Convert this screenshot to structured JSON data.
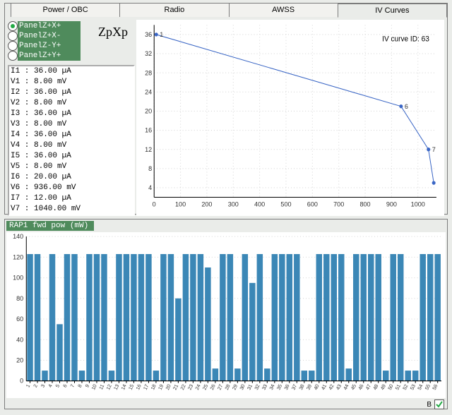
{
  "tabs": {
    "items": [
      "Power / OBC",
      "Radio",
      "AWSS",
      "IV Curves"
    ],
    "active": 3
  },
  "iv": {
    "panel_label": "ZpXp",
    "radios": [
      {
        "label": "PanelZ+X+",
        "checked": true
      },
      {
        "label": "PanelZ+X-",
        "checked": false
      },
      {
        "label": "PanelZ-Y+",
        "checked": false
      },
      {
        "label": "PanelZ+Y+",
        "checked": false
      }
    ],
    "readings_text": [
      "I1 : 36.00 µA",
      "V1 : 8.00 mV",
      "I2 : 36.00 µA",
      "V2 : 8.00 mV",
      "I3 : 36.00 µA",
      "V3 : 8.00 mV",
      "I4 : 36.00 µA",
      "V4 : 8.00 mV",
      "I5 : 36.00 µA",
      "V5 : 8.00 mV",
      "I6 : 20.00 µA",
      "V6 : 936.00 mV",
      "I7 : 12.00 µA",
      "V7 : 1040.00 mV"
    ],
    "annotation": "IV curve ID: 63"
  },
  "bottom": {
    "title": "RAP1 fwd pow (mW)",
    "checkbox_label": "B",
    "checked": true
  },
  "chart_data": [
    {
      "type": "line",
      "title": "",
      "xlabel": "",
      "ylabel": "",
      "x_ticks": [
        0,
        100,
        200,
        300,
        400,
        500,
        600,
        700,
        800,
        900,
        1000
      ],
      "y_ticks": [
        4,
        8,
        12,
        16,
        20,
        24,
        28,
        32,
        36
      ],
      "xlim": [
        0,
        1070
      ],
      "ylim": [
        2,
        38
      ],
      "annotation": "IV curve ID: 63",
      "series": [
        {
          "name": "IV",
          "color": "#3a66c5",
          "x": [
            8,
            936,
            1040,
            1060
          ],
          "y": [
            36,
            21,
            12,
            5
          ],
          "marker_label": [
            "1",
            "6",
            "7",
            ""
          ]
        }
      ]
    },
    {
      "type": "bar",
      "title": "RAP1 fwd pow (mW)",
      "xlabel": "",
      "ylabel": "",
      "y_ticks": [
        0,
        20,
        40,
        60,
        80,
        100,
        120,
        140
      ],
      "ylim": [
        0,
        140
      ],
      "categories": [
        "1",
        "2",
        "3",
        "4",
        "5",
        "6",
        "7",
        "8",
        "9",
        "10",
        "11",
        "12",
        "13",
        "14",
        "15",
        "16",
        "17",
        "18",
        "19",
        "20",
        "21",
        "22",
        "23",
        "24",
        "25",
        "26",
        "27",
        "28",
        "29",
        "30",
        "31",
        "32",
        "33",
        "34",
        "35",
        "36",
        "37",
        "38",
        "39",
        "40",
        "41",
        "42",
        "43",
        "44",
        "45",
        "46",
        "47",
        "48",
        "49",
        "50",
        "51",
        "52",
        "53",
        "54",
        "55",
        "56"
      ],
      "values": [
        123,
        123,
        10,
        123,
        55,
        123,
        123,
        10,
        123,
        123,
        123,
        10,
        123,
        123,
        123,
        123,
        123,
        10,
        123,
        123,
        80,
        123,
        123,
        123,
        110,
        12,
        123,
        123,
        12,
        123,
        95,
        123,
        12,
        123,
        123,
        123,
        123,
        10,
        10,
        123,
        123,
        123,
        123,
        12,
        123,
        123,
        123,
        123,
        10,
        123,
        123,
        10,
        10,
        123,
        123,
        123
      ],
      "color": "#3b87b6"
    }
  ]
}
